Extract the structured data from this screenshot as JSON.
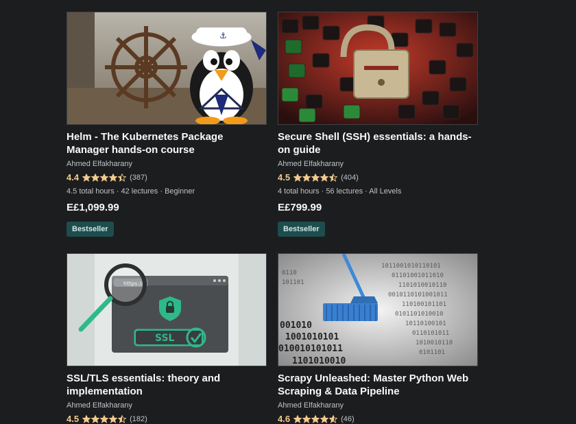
{
  "courses": [
    {
      "title": "Helm - The Kubernetes Package Manager hands-on course",
      "author": "Ahmed Elfakharany",
      "rating": "4.4",
      "rating_value": 4.4,
      "reviews": "(387)",
      "meta": "4.5 total hours · 42 lectures · Beginner",
      "price": "E£1,099.99",
      "badge": "Bestseller",
      "thumbnail": "sailor-penguin-ship-wheel"
    },
    {
      "title": "Secure Shell (SSH) essentials: a hands-on guide",
      "author": "Ahmed Elfakharany",
      "rating": "4.5",
      "rating_value": 4.5,
      "reviews": "(404)",
      "meta": "4 total hours · 56 lectures · All Levels",
      "price": "E£799.99",
      "badge": "Bestseller",
      "thumbnail": "padlock-on-keyboard"
    },
    {
      "title": "SSL/TLS essentials: theory and implementation",
      "author": "Ahmed Elfakharany",
      "rating": "4.5",
      "rating_value": 4.5,
      "reviews": "(182)",
      "thumbnail": "https-ssl-browser"
    },
    {
      "title": "Scrapy Unleashed: Master Python Web Scraping & Data Pipeline",
      "author": "Ahmed Elfakharany",
      "rating": "4.6",
      "rating_value": 4.6,
      "reviews": "(46)",
      "thumbnail": "broom-binary-data"
    }
  ],
  "thumb_text": {
    "https": "https://",
    "ssl": "SSL"
  },
  "colors": {
    "background": "#1c1d1f",
    "rating": "#f3ca8c",
    "badge_bg": "#1e4d4e",
    "badge_text": "#cde7e4"
  }
}
